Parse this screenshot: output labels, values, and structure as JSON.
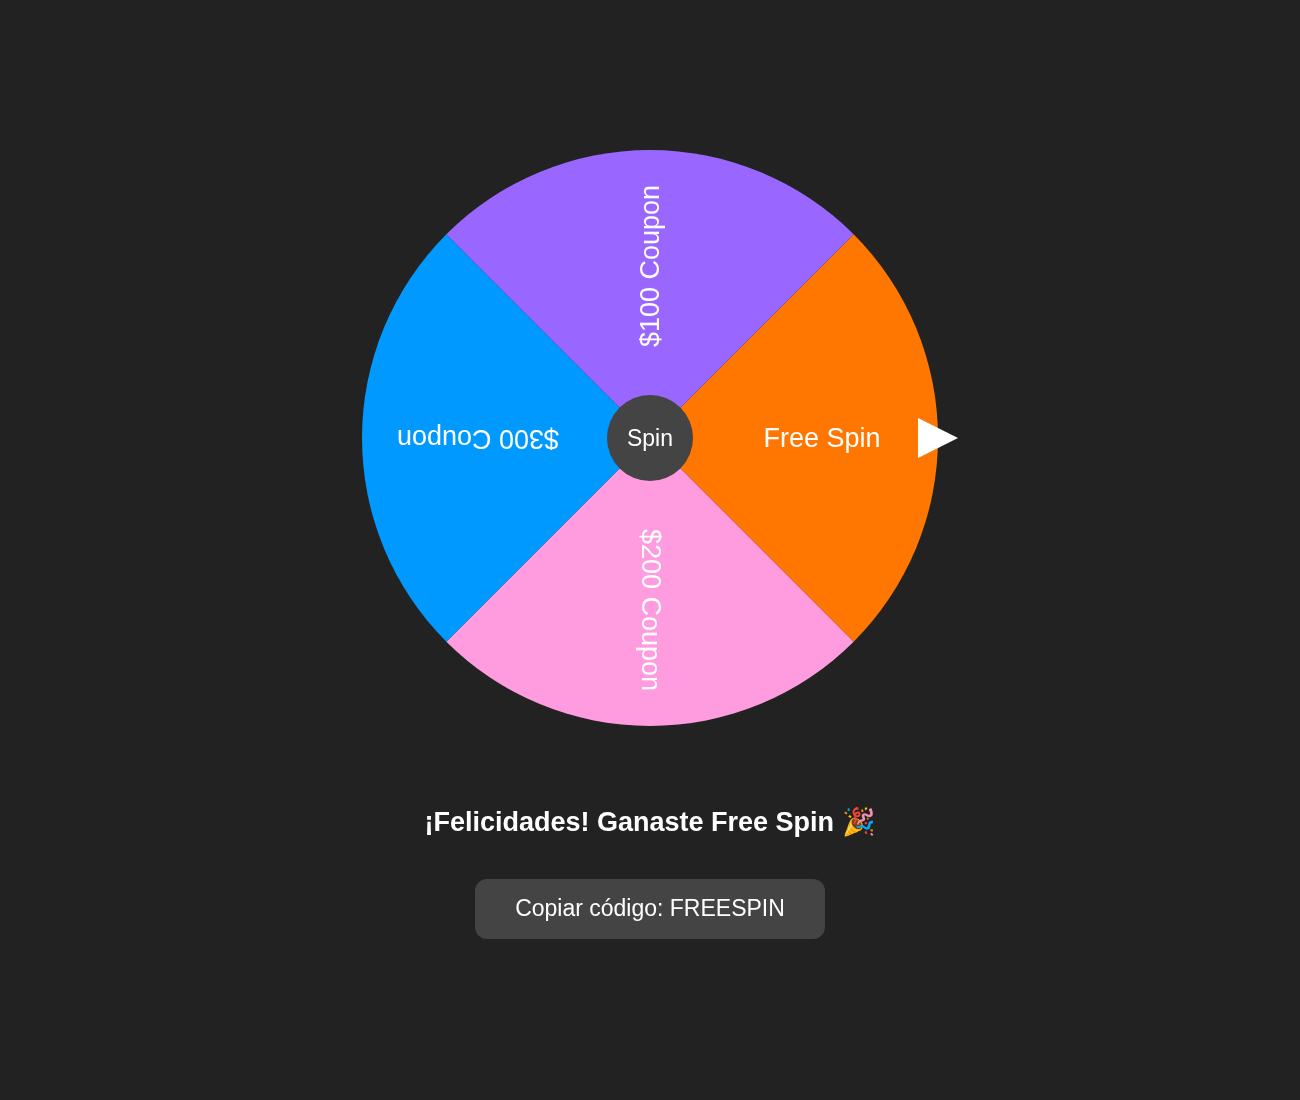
{
  "wheel": {
    "segments": [
      {
        "label": "Free Spin",
        "color": "#ff7700"
      },
      {
        "label": "$200 Coupon",
        "color": "#ff9ce0"
      },
      {
        "label": "$300 Coupon",
        "color": "#0099ff"
      },
      {
        "label": "$100 Coupon",
        "color": "#9966ff"
      }
    ],
    "center_button": "Spin"
  },
  "result_message": "¡Felicidades! Ganaste Free Spin 🎉",
  "copy_button": "Copiar código: FREESPIN"
}
